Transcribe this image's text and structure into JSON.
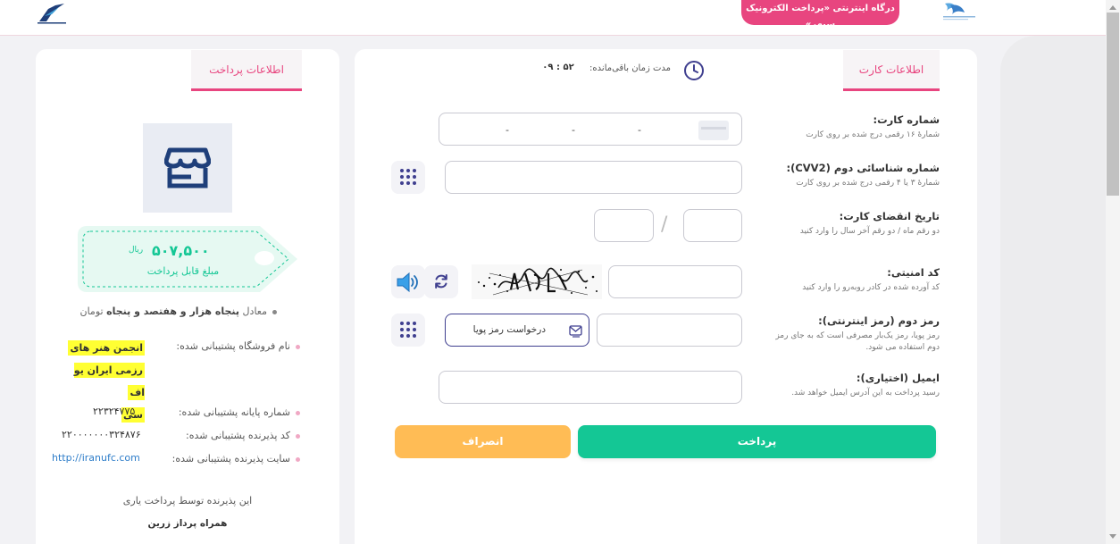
{
  "header": {
    "gateway_title": "درگاه اینترنتی «پرداخت الکترونیک سپهر»"
  },
  "card_panel": {
    "tab_label": "اطلاعات کارت",
    "timer_label": "مدت زمان باقی‌مانده:",
    "timer_value": "۰۹ : ۵۲",
    "card_number": {
      "label": "شماره کارت:",
      "hint": "شمارهٔ ۱۶ رقمی درج شده بر روی کارت",
      "separator": "-"
    },
    "cvv2": {
      "label": "شماره شناسائی دوم (CVV2):",
      "hint": "شمارهٔ ۳ یا ۴ رقمی درج شده بر روی کارت"
    },
    "expiry": {
      "label": "تاریخ انقضای کارت:",
      "hint": "دو رقم ماه / دو رقم آخر سال را وارد کنید",
      "separator": "/"
    },
    "captcha": {
      "label": "کد امنیتی:",
      "hint": "کد آورده شده در کادر روبه‌رو را وارد کنید"
    },
    "pin2": {
      "label": "رمز دوم (رمز اینترنتی):",
      "hint": "رمز پویا، رمز یک‌بار مصرفی است که به جای رمز دوم استفاده می شود.",
      "dynamic_button": "درخواست رمز پویا"
    },
    "email": {
      "label": "ایمیل (اختیاری):",
      "hint": "رسید پرداخت به این آدرس ایمیل خواهد شد."
    },
    "pay_button": "پرداخت",
    "cancel_button": "انصراف"
  },
  "payment_panel": {
    "tab_label": "اطلاعات پرداخت",
    "amount": "۵۰۷,۵۰۰",
    "currency": "ریال",
    "amount_caption": "مبلغ قابل پرداخت",
    "equivalent_prefix": "معادل",
    "equivalent_words": "پنجاه هزار و هفتصد و پنجاه",
    "equivalent_unit": "تومان",
    "store_label": "نام فروشگاه پشتیبانی شده:",
    "store_name_lines": [
      "انجمن هنر های",
      "رزمی ایران یو اف",
      "سی"
    ],
    "terminal_label": "شماره پایانه پشتیبانی شده:",
    "terminal_value": "۲۲۳۲۴۷۷۵",
    "merchant_label": "کد پذیرنده پشتیبانی شده:",
    "merchant_value": "۲۲۰۰۰۰۰۰۰۳۲۴۸۷۶",
    "site_label": "سایت پذیرنده پشتیبانی شده:",
    "site_value": "http://iranufc.com",
    "footer_line1": "این پذیرنده توسط پرداخت یاری",
    "footer_line2": "همراه پرداز زرین"
  },
  "colors": {
    "brand_pink": "#e8457f",
    "success_green": "#14c795",
    "cancel_orange": "#ffbc55",
    "icon_navy": "#3f3f8f",
    "speaker_blue": "#3aa0e8"
  },
  "icons": [
    "card-icon",
    "keypad-icon",
    "refresh-icon",
    "speaker-icon",
    "clock-icon",
    "store-icon",
    "mobile-message-icon"
  ]
}
